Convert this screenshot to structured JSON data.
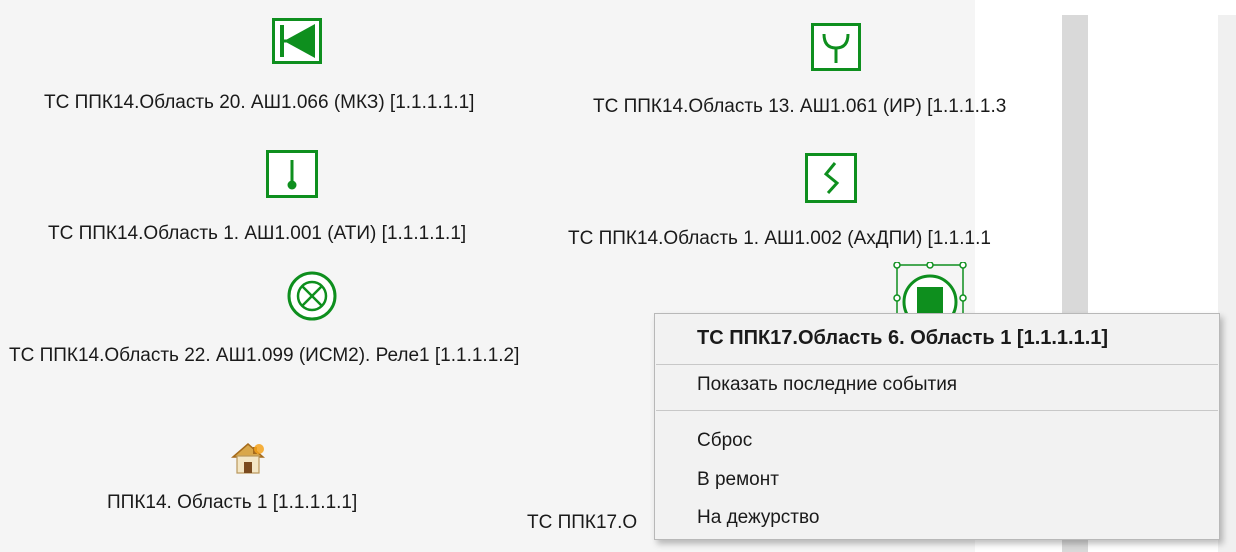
{
  "map": {
    "sensors": [
      {
        "label": "ТС ППК14.Область 20. АШ1.066 (МКЗ) [1.1.1.1.1]",
        "icon": "flag-sensor-icon"
      },
      {
        "label": "ТС ППК14.Область 13. АШ1.061 (ИР) [1.1.1.1.3",
        "icon": "y-shape-sensor-icon"
      },
      {
        "label": "ТС ППК14.Область 1. АШ1.001 (АТИ) [1.1.1.1.1]",
        "icon": "thermometer-sensor-icon"
      },
      {
        "label": "ТС ППК14.Область 1. АШ1.002 (АхДПИ) [1.1.1.1",
        "icon": "zigzag-sensor-icon"
      },
      {
        "label": "ТС ППК14.Область 22. АШ1.099 (ИСМ2). Реле1 [1.1.1.1.2]",
        "icon": "relay-circle-x-icon"
      },
      {
        "label": "ППК14. Область 1 [1.1.1.1.1]",
        "icon": "house-icon"
      },
      {
        "label": "ТС ППК17.О",
        "icon": ""
      }
    ],
    "selected_icon": "selected-area-circle-icon"
  },
  "context_menu": {
    "header": "ТС ППК17.Область 6. Область 1 [1.1.1.1.1]",
    "items": [
      "Показать последние события",
      "Сброс",
      "В ремонт",
      "На дежурство"
    ]
  },
  "colors": {
    "icon_green": "#0e8f1e",
    "map_background": "#f5f5f5",
    "menu_background": "#f2f2f2"
  }
}
